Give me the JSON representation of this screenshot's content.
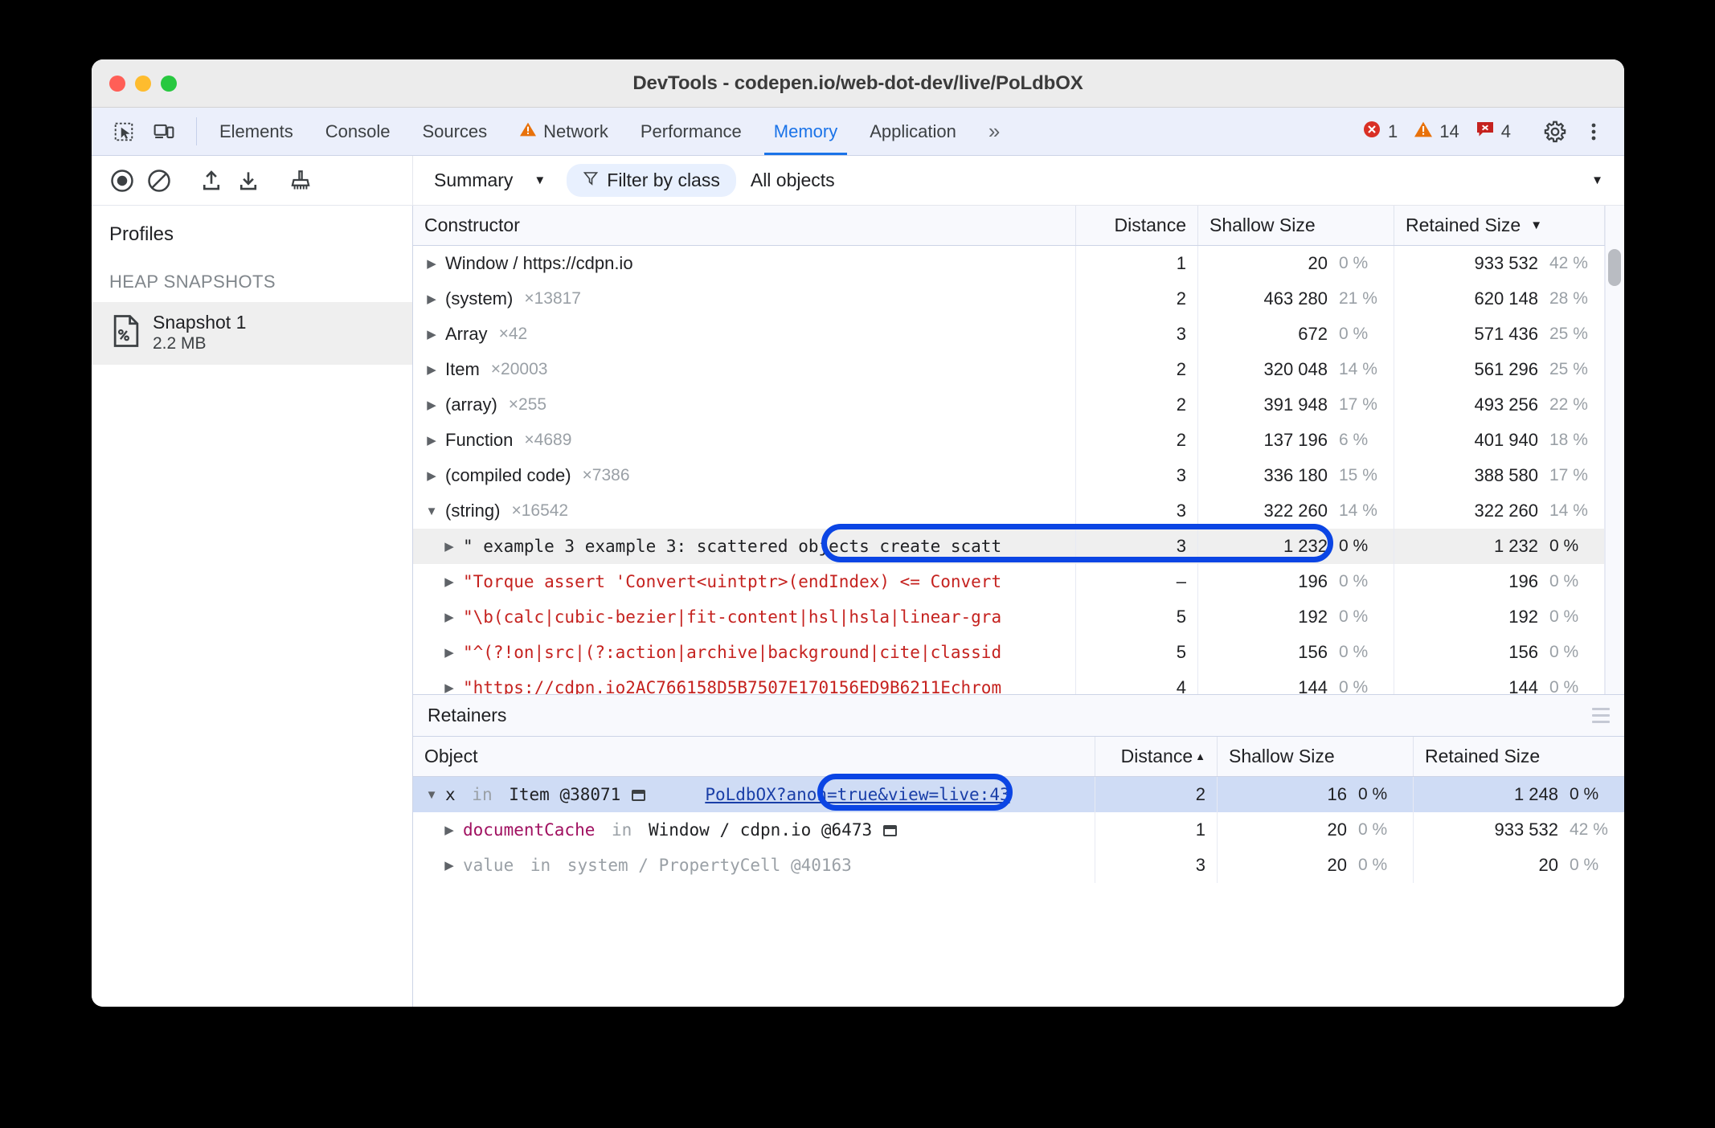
{
  "window": {
    "title": "DevTools - codepen.io/web-dot-dev/live/PoLdbOX",
    "traffic_lights": [
      "close-red",
      "minimize-yellow",
      "maximize-green"
    ]
  },
  "tabbar": {
    "left_icons": [
      "inspect-element-icon",
      "device-toolbar-icon"
    ],
    "tabs": [
      {
        "label": "Elements",
        "active": false,
        "warn": false
      },
      {
        "label": "Console",
        "active": false,
        "warn": false
      },
      {
        "label": "Sources",
        "active": false,
        "warn": false
      },
      {
        "label": "Network",
        "active": false,
        "warn": true
      },
      {
        "label": "Performance",
        "active": false,
        "warn": false
      },
      {
        "label": "Memory",
        "active": true,
        "warn": false
      },
      {
        "label": "Application",
        "active": false,
        "warn": false
      }
    ],
    "more_tabs_label": "»",
    "counters": {
      "errors": "1",
      "warnings": "14",
      "issues": "4"
    },
    "settings_icon": "gear-icon",
    "more_icon": "kebab-menu-icon"
  },
  "toolbar": {
    "record_icon": "record-heap-snapshot-icon",
    "clear_icon": "clear-all-profiles-icon",
    "load_icon": "load-profile-icon",
    "save_icon": "save-profile-icon",
    "collect_garbage_icon": "collect-garbage-icon",
    "view_select": "Summary",
    "filter_chip": "Filter by class",
    "filter_icon": "filter-icon",
    "object_select": "All objects"
  },
  "sidebar": {
    "title": "Profiles",
    "section": "HEAP SNAPSHOTS",
    "snapshot": {
      "icon": "heap-snapshot-file-icon",
      "name": "Snapshot 1",
      "size": "2.2 MB"
    }
  },
  "constructors_grid": {
    "columns": [
      "Constructor",
      "Distance",
      "Shallow Size",
      "Retained Size"
    ],
    "sort_column": "Retained Size",
    "sort_dir": "desc",
    "rows": [
      {
        "name": "Window / https://cdpn.io",
        "count": "",
        "distance": "1",
        "shallow": "20",
        "shallow_pct": "0 %",
        "retained": "933 532",
        "retained_pct": "42 %",
        "expanded": false,
        "style": "plain",
        "selected": false
      },
      {
        "name": "(system)",
        "count": "×13817",
        "distance": "2",
        "shallow": "463 280",
        "shallow_pct": "21 %",
        "retained": "620 148",
        "retained_pct": "28 %",
        "expanded": false,
        "style": "plain",
        "selected": false
      },
      {
        "name": "Array",
        "count": "×42",
        "distance": "3",
        "shallow": "672",
        "shallow_pct": "0 %",
        "retained": "571 436",
        "retained_pct": "25 %",
        "expanded": false,
        "style": "plain",
        "selected": false
      },
      {
        "name": "Item",
        "count": "×20003",
        "distance": "2",
        "shallow": "320 048",
        "shallow_pct": "14 %",
        "retained": "561 296",
        "retained_pct": "25 %",
        "expanded": false,
        "style": "plain",
        "selected": false
      },
      {
        "name": "(array)",
        "count": "×255",
        "distance": "2",
        "shallow": "391 948",
        "shallow_pct": "17 %",
        "retained": "493 256",
        "retained_pct": "22 %",
        "expanded": false,
        "style": "plain",
        "selected": false
      },
      {
        "name": "Function",
        "count": "×4689",
        "distance": "2",
        "shallow": "137 196",
        "shallow_pct": "6 %",
        "retained": "401 940",
        "retained_pct": "18 %",
        "expanded": false,
        "style": "plain",
        "selected": false
      },
      {
        "name": "(compiled code)",
        "count": "×7386",
        "distance": "3",
        "shallow": "336 180",
        "shallow_pct": "15 %",
        "retained": "388 580",
        "retained_pct": "17 %",
        "expanded": false,
        "style": "plain",
        "selected": false
      },
      {
        "name": "(string)",
        "count": "×16542",
        "distance": "3",
        "shallow": "322 260",
        "shallow_pct": "14 %",
        "retained": "322 260",
        "retained_pct": "14 %",
        "expanded": true,
        "style": "plain",
        "selected": false
      },
      {
        "name": "\" example 3 example 3: scattered objects create scatt",
        "count": "",
        "distance": "3",
        "shallow": "1 232",
        "shallow_pct": "0 %",
        "retained": "1 232",
        "retained_pct": "0 %",
        "expanded": false,
        "style": "mono-child",
        "selected": true
      },
      {
        "name": "\"Torque assert 'Convert<uintptr>(endIndex) <= Convert",
        "count": "",
        "distance": "–",
        "shallow": "196",
        "shallow_pct": "0 %",
        "retained": "196",
        "retained_pct": "0 %",
        "expanded": false,
        "style": "red-child",
        "selected": false
      },
      {
        "name": "\"\\b(calc|cubic-bezier|fit-content|hsl|hsla|linear-gra",
        "count": "",
        "distance": "5",
        "shallow": "192",
        "shallow_pct": "0 %",
        "retained": "192",
        "retained_pct": "0 %",
        "expanded": false,
        "style": "red-child",
        "selected": false
      },
      {
        "name": "\"^(?!on|src|(?:action|archive|background|cite|classid",
        "count": "",
        "distance": "5",
        "shallow": "156",
        "shallow_pct": "0 %",
        "retained": "156",
        "retained_pct": "0 %",
        "expanded": false,
        "style": "red-child",
        "selected": false
      },
      {
        "name": "\"https://cdpn.io2AC766158D5B7507E170156ED9B6211Echrom",
        "count": "",
        "distance": "4",
        "shallow": "144",
        "shallow_pct": "0 %",
        "retained": "144",
        "retained_pct": "0 %",
        "expanded": false,
        "style": "red-child",
        "selected": false
      }
    ]
  },
  "retainers": {
    "title": "Retainers",
    "menu_icon": "hamburger-menu-icon",
    "columns": [
      "Object",
      "Distance",
      "Shallow Size",
      "Retained Size"
    ],
    "sort_column": "Distance",
    "sort_dir": "asc",
    "rows": [
      {
        "prop": "x",
        "in_word": "in",
        "holder": "Item @38071",
        "node_badge": true,
        "link": "PoLdbOX?anon=true&view=live:43",
        "distance": "2",
        "shallow": "16",
        "shallow_pct": "0 %",
        "retained": "1 248",
        "retained_pct": "0 %",
        "expanded": true,
        "selected": true,
        "style": "normal"
      },
      {
        "prop": "documentCache",
        "in_word": "in",
        "holder": "Window / cdpn.io @6473",
        "node_badge": true,
        "link": "",
        "distance": "1",
        "shallow": "20",
        "shallow_pct": "0 %",
        "retained": "933 532",
        "retained_pct": "42 %",
        "expanded": false,
        "selected": false,
        "style": "key"
      },
      {
        "prop": "value",
        "in_word": "in",
        "holder": "system / PropertyCell @40163",
        "node_badge": false,
        "link": "",
        "distance": "3",
        "shallow": "20",
        "shallow_pct": "0 %",
        "retained": "20",
        "retained_pct": "0 %",
        "expanded": false,
        "selected": false,
        "style": "dim"
      }
    ]
  },
  "annotations": {
    "accent_color": "#0b45e4",
    "highlight_1": "string-row-example-3",
    "highlight_2": "retainer-row-x-in-item"
  },
  "colors": {
    "accent_blue": "#1a73e8",
    "error_red": "#d93025",
    "warning_orange": "#e8710a",
    "issue_red": "#c5221f",
    "string_red": "#c5221f",
    "link_blue": "#1a3fa8",
    "selected_blue": "#cfdcf5",
    "tabbar_bg": "#ebeffb"
  }
}
